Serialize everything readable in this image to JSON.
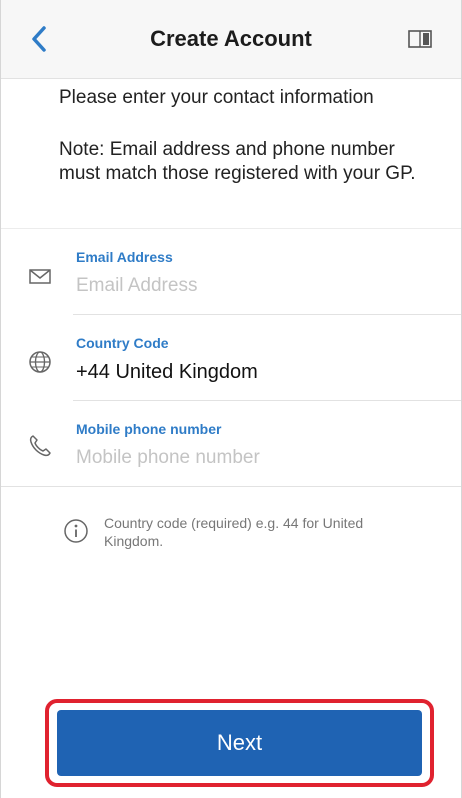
{
  "header": {
    "title": "Create Account",
    "back_icon": "chevron-left-icon",
    "reader_icon": "reader-icon"
  },
  "intro": "Please enter your contact information",
  "note": "Note: Email address and phone number must match those registered with your GP.",
  "form": {
    "email": {
      "label": "Email Address",
      "placeholder": "Email Address",
      "value": "",
      "icon": "envelope-icon"
    },
    "country": {
      "label": "Country Code",
      "value": "+44 United Kingdom",
      "icon": "globe-icon"
    },
    "phone": {
      "label": "Mobile phone number",
      "placeholder": "Mobile phone number",
      "value": "",
      "icon": "phone-icon"
    }
  },
  "info": {
    "text": "Country code (required) e.g. 44 for United Kingdom.",
    "icon": "info-icon"
  },
  "actions": {
    "next_label": "Next",
    "highlight_color": "#e0222f",
    "button_color": "#1f63b3",
    "accent_color": "#2f7cc7"
  }
}
